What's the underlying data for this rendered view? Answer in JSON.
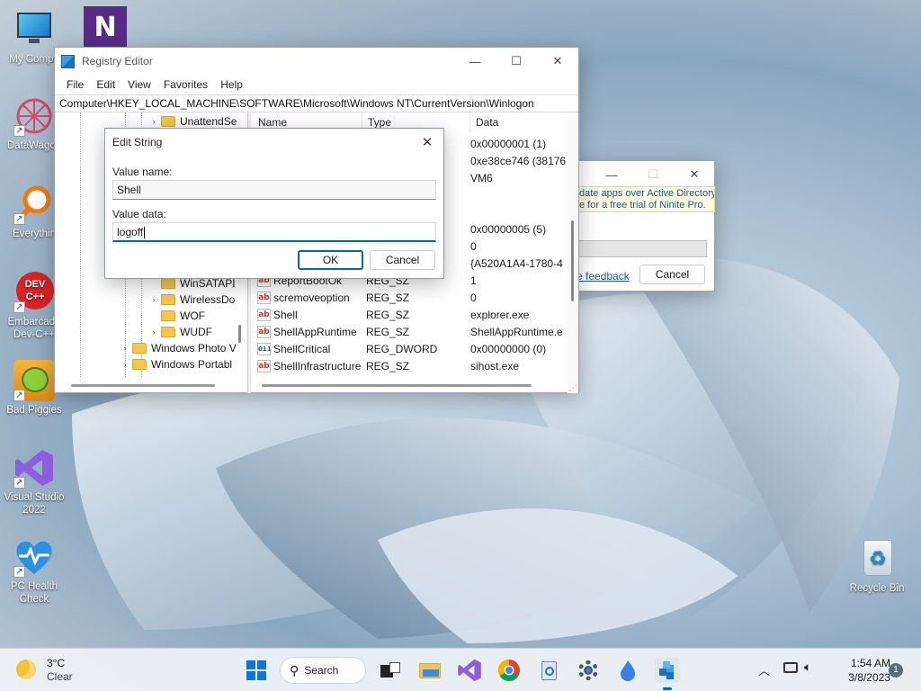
{
  "desktop": {
    "icons": [
      {
        "label": "My Compu"
      },
      {
        "label": "DataWagon"
      },
      {
        "label": "Everythin"
      },
      {
        "label": "Embarcade Dev-C++"
      },
      {
        "label": "Bad Piggies"
      },
      {
        "label": "Visual Studio 2022"
      },
      {
        "label": "PC Health Check"
      },
      {
        "label": "Recycle Bin"
      }
    ]
  },
  "regedit": {
    "title": "Registry Editor",
    "menu": [
      "File",
      "Edit",
      "View",
      "Favorites",
      "Help"
    ],
    "address": "Computer\\HKEY_LOCAL_MACHINE\\SOFTWARE\\Microsoft\\Windows NT\\CurrentVersion\\Winlogon",
    "tree": [
      {
        "label": "UnattendSe"
      },
      {
        "label": "WinSATAPI"
      },
      {
        "label": "WirelessDo"
      },
      {
        "label": "WOF"
      },
      {
        "label": "WUDF"
      },
      {
        "label": "Windows Photo V"
      },
      {
        "label": "Windows Portabl"
      }
    ],
    "columns": {
      "name": "Name",
      "type": "Type",
      "data": "Data"
    },
    "top_data": [
      "0x00000001 (1)",
      "0xe38ce746 (38176",
      "VM6"
    ],
    "mid_data": [
      "0x00000005 (5)",
      "0",
      "{A520A1A4-1780-4"
    ],
    "rows": [
      {
        "name": "ReportBootOk",
        "type": "REG_SZ",
        "data": "1"
      },
      {
        "name": "scremoveoption",
        "type": "REG_SZ",
        "data": "0"
      },
      {
        "name": "Shell",
        "type": "REG_SZ",
        "data": "explorer.exe"
      },
      {
        "name": "ShellAppRuntime",
        "type": "REG_SZ",
        "data": "ShellAppRuntime.e"
      },
      {
        "name": "ShellCritical",
        "type": "REG_DWORD",
        "data": "0x00000000 (0)"
      },
      {
        "name": "ShellInfrastructure",
        "type": "REG_SZ",
        "data": "sihost.exe"
      }
    ]
  },
  "ninite": {
    "line1": "date apps over Active Directory.",
    "line2": "e for a free trial of Ninite Pro.",
    "feedback": "e feedback",
    "cancel": "Cancel"
  },
  "dialog": {
    "title": "Edit String",
    "value_name_label": "Value name:",
    "value_name": "Shell",
    "value_data_label": "Value data:",
    "value_data": "logoff",
    "ok": "OK",
    "cancel": "Cancel"
  },
  "taskbar": {
    "weather_temp": "3°C",
    "weather_desc": "Clear",
    "search": "Search",
    "time": "1:54 AM",
    "date": "3/8/2023",
    "notifications": "1"
  },
  "colors": {
    "accent": "#0067c0",
    "link": "#1c57a5"
  }
}
